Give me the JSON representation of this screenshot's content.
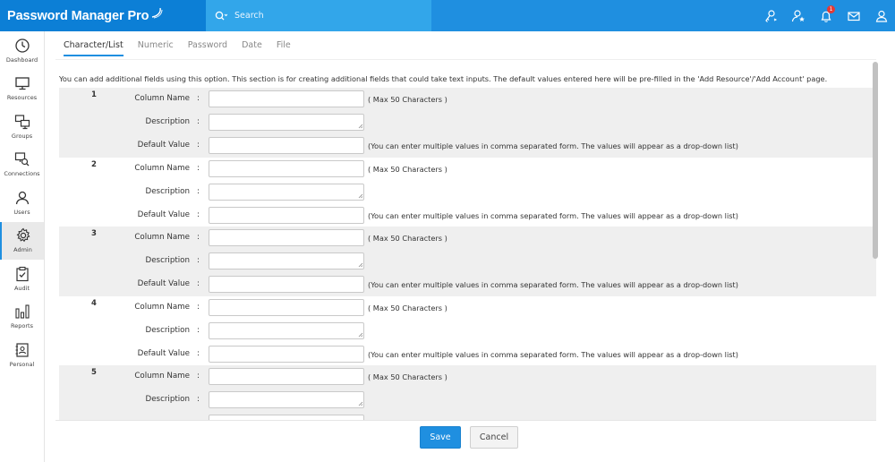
{
  "app": {
    "title": "Password Manager Pro"
  },
  "search": {
    "placeholder": "Search"
  },
  "topbar_icons": [
    "key-user-icon",
    "user-star-icon",
    "bell-icon",
    "mail-icon",
    "user-account-icon"
  ],
  "notifications": {
    "count": "1"
  },
  "sidebar": {
    "items": [
      {
        "label": "Dashboard",
        "icon": "dashboard-icon"
      },
      {
        "label": "Resources",
        "icon": "monitor-icon"
      },
      {
        "label": "Groups",
        "icon": "groups-icon"
      },
      {
        "label": "Connections",
        "icon": "connections-icon"
      },
      {
        "label": "Users",
        "icon": "user-icon"
      },
      {
        "label": "Admin",
        "icon": "gear-icon",
        "active": true
      },
      {
        "label": "Audit",
        "icon": "clipboard-icon"
      },
      {
        "label": "Reports",
        "icon": "bar-chart-icon"
      },
      {
        "label": "Personal",
        "icon": "contact-book-icon"
      }
    ]
  },
  "tabs": [
    {
      "label": "Character/List",
      "active": true
    },
    {
      "label": "Numeric"
    },
    {
      "label": "Password"
    },
    {
      "label": "Date"
    },
    {
      "label": "File"
    }
  ],
  "intro": "You can add additional fields using this option. This section is for creating additional fields that could take text inputs. The default values entered here will be pre-filled in the 'Add Resource'/'Add Account' page.",
  "form": {
    "labels": {
      "column_name": "Column Name",
      "description": "Description",
      "default_value": "Default Value",
      "colon": ":"
    },
    "hints": {
      "max_chars": "( Max 50 Characters )",
      "default_value": "(You can enter multiple values in comma separated form. The values will appear as a drop-down list)"
    },
    "fields": [
      {
        "number": "1",
        "column_name": "",
        "description": "",
        "default_value": ""
      },
      {
        "number": "2",
        "column_name": "",
        "description": "",
        "default_value": ""
      },
      {
        "number": "3",
        "column_name": "",
        "description": "",
        "default_value": ""
      },
      {
        "number": "4",
        "column_name": "",
        "description": "",
        "default_value": ""
      },
      {
        "number": "5",
        "column_name": "",
        "description": "",
        "default_value": ""
      }
    ]
  },
  "buttons": {
    "save": "Save",
    "cancel": "Cancel"
  },
  "colors": {
    "primary": "#1f8fe0",
    "logo_bg": "#0c7fd6",
    "search_bg": "#32a6ea",
    "badge": "#e53935"
  }
}
